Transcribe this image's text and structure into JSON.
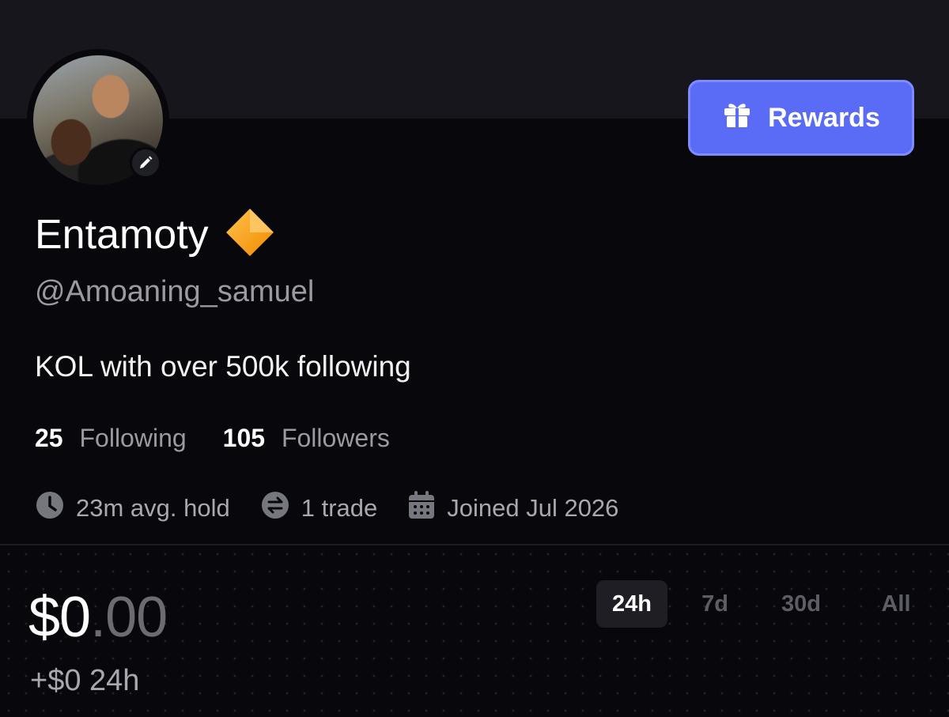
{
  "header": {
    "rewards_label": "Rewards",
    "rewards_icon": "gift-icon",
    "accent_color": "#5a6cf6"
  },
  "profile": {
    "avatar_alt": "profile photo",
    "edit_icon": "pencil-icon",
    "name": "Entamoty",
    "badge_icon": "orange-diamond-icon",
    "handle": "@Amoaning_samuel",
    "bio": "KOL with over 500k following",
    "following_count": "25",
    "following_label": "Following",
    "followers_count": "105",
    "followers_label": "Followers",
    "stats": [
      {
        "icon": "clock-icon",
        "text": "23m avg. hold"
      },
      {
        "icon": "swap-icon",
        "text": "1 trade"
      },
      {
        "icon": "calendar-icon",
        "text": "Joined Jul 2026"
      }
    ]
  },
  "portfolio": {
    "balance_int": "$0",
    "balance_dec": ".00",
    "change": "+$0 24h",
    "tabs": [
      {
        "label": "24h",
        "active": true
      },
      {
        "label": "7d",
        "active": false
      },
      {
        "label": "30d",
        "active": false
      },
      {
        "label": "All",
        "active": false
      }
    ]
  }
}
